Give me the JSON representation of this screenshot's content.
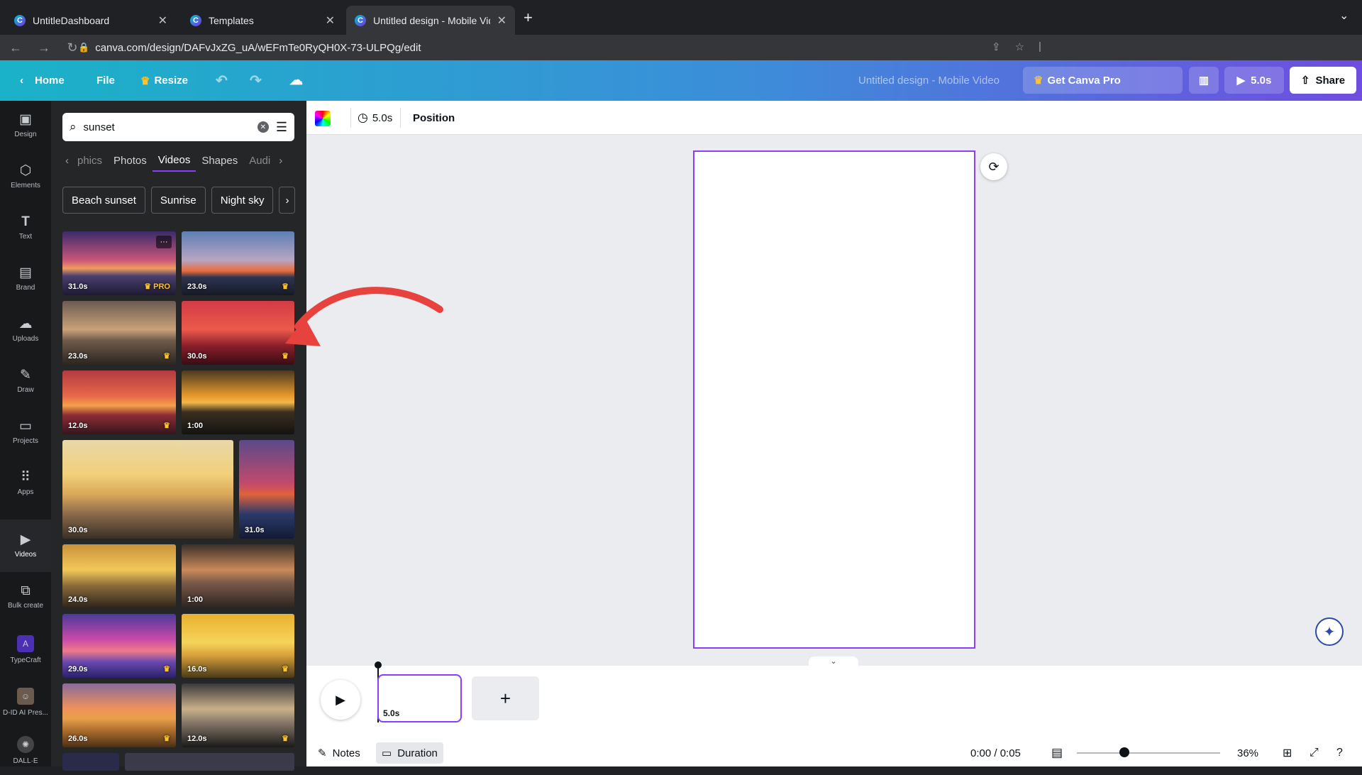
{
  "browser": {
    "tabs": [
      {
        "title": "UntitleDashboard"
      },
      {
        "title": "Templates"
      },
      {
        "title": "Untitled design - Mobile Video"
      }
    ],
    "url": "canva.com/design/DAFvJxZG_uA/wEFmTe0RyQH0X-73-ULPQg/edit"
  },
  "topbar": {
    "home": "Home",
    "file": "File",
    "resize": "Resize",
    "doc_title": "Untitled design - Mobile Video",
    "get_pro": "Get Canva Pro",
    "play_duration": "5.0s",
    "share": "Share"
  },
  "rail": [
    {
      "label": "Design",
      "icon": "design-icon"
    },
    {
      "label": "Elements",
      "icon": "elements-icon"
    },
    {
      "label": "Text",
      "icon": "text-icon"
    },
    {
      "label": "Brand",
      "icon": "brand-icon"
    },
    {
      "label": "Uploads",
      "icon": "cloud-upload-icon"
    },
    {
      "label": "Draw",
      "icon": "pen-icon"
    },
    {
      "label": "Projects",
      "icon": "folder-icon"
    },
    {
      "label": "Apps",
      "icon": "grid-icon"
    },
    {
      "label": "Videos",
      "icon": "video-icon"
    },
    {
      "label": "Bulk create",
      "icon": "bulk-icon"
    },
    {
      "label": "TypeCraft",
      "icon": "typecraft-icon"
    },
    {
      "label": "D-ID AI Pres...",
      "icon": "did-icon"
    },
    {
      "label": "DALL·E",
      "icon": "dalle-icon"
    }
  ],
  "panel": {
    "search_value": "sunset",
    "category_tabs": [
      "phics",
      "Photos",
      "Videos",
      "Shapes",
      "Audi"
    ],
    "active_tab": "Videos",
    "chips": [
      "Beach sunset",
      "Sunrise",
      "Night sky"
    ],
    "videos": [
      {
        "duration": "31.0s",
        "badge": "PRO"
      },
      {
        "duration": "23.0s",
        "badge": ""
      },
      {
        "duration": "23.0s",
        "badge": ""
      },
      {
        "duration": "30.0s",
        "badge": ""
      },
      {
        "duration": "12.0s",
        "badge": ""
      },
      {
        "duration": "1:00",
        "badge": ""
      },
      {
        "duration": "30.0s",
        "badge": ""
      },
      {
        "duration": "31.0s",
        "badge": ""
      },
      {
        "duration": "24.0s",
        "badge": ""
      },
      {
        "duration": "1:00",
        "badge": ""
      },
      {
        "duration": "29.0s",
        "badge": ""
      },
      {
        "duration": "16.0s",
        "badge": ""
      },
      {
        "duration": "26.0s",
        "badge": ""
      },
      {
        "duration": "12.0s",
        "badge": ""
      }
    ]
  },
  "editor_toolbar": {
    "duration": "5.0s",
    "position": "Position"
  },
  "timeline": {
    "clip_duration": "5.0s",
    "notes": "Notes",
    "duration_btn": "Duration",
    "time": "0:00 / 0:05",
    "zoom": "36%"
  },
  "colors": {
    "accent": "#8b3dff",
    "annotation_arrow": "#e8423f"
  }
}
